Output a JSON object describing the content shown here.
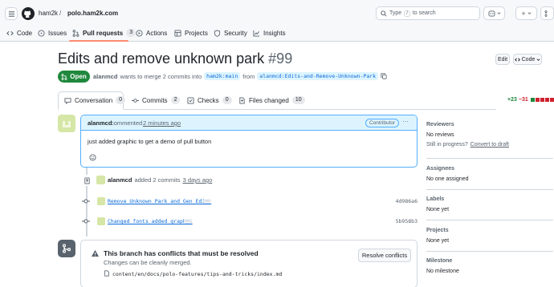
{
  "header": {
    "owner": "ham2k",
    "separator": "/",
    "repo": "polo.ham2k.com",
    "search_prefix": "Type",
    "search_key": "/",
    "search_suffix": "to search",
    "plus_label": "+"
  },
  "repo_tabs": [
    {
      "label": "Code",
      "icon": "code-icon"
    },
    {
      "label": "Issues",
      "icon": "issue-icon"
    },
    {
      "label": "Pull requests",
      "icon": "pull-request-icon",
      "count": "3"
    },
    {
      "label": "Actions",
      "icon": "play-icon"
    },
    {
      "label": "Projects",
      "icon": "table-icon"
    },
    {
      "label": "Security",
      "icon": "shield-icon"
    },
    {
      "label": "Insights",
      "icon": "graph-icon"
    }
  ],
  "pr": {
    "title": "Edits and remove unknown park",
    "number": "#99",
    "edit_label": "Edit",
    "code_label": "Code",
    "status": "Open",
    "author": "alanmcd",
    "merge_text_1": "wants to merge 2 commits into",
    "base_branch": "ham2k:main",
    "from_text": "from",
    "head_branch": "alanmcd:Edits-and-Remove-Unknown-Park"
  },
  "pr_tabs": [
    {
      "label": "Conversation",
      "count": "0"
    },
    {
      "label": "Commits",
      "count": "2"
    },
    {
      "label": "Checks",
      "count": "0"
    },
    {
      "label": "Files changed",
      "count": "10"
    }
  ],
  "diffstat": {
    "added": "+23",
    "removed": "−31"
  },
  "comment": {
    "author": "alanmcd",
    "action": "commented",
    "time": "2 minutes ago",
    "role": "Contributor",
    "more": "···",
    "body": "just added graphic to get a demo of pull button",
    "reaction_icon": "smiley-icon"
  },
  "commits_event": {
    "author": "alanmcd",
    "text": "added 2 commits",
    "time": "3 days ago",
    "commits": [
      {
        "message": "Remove Unknown Park and Gen Edits",
        "sha": "4d986a6",
        "more": "···"
      },
      {
        "message": "Changed fonts added graphic",
        "sha": "5b958b3",
        "more": "···"
      }
    ]
  },
  "merge": {
    "title": "This branch has conflicts that must be resolved",
    "subtitle": "Changes can be cleanly merged.",
    "resolve_label": "Resolve conflicts",
    "file": "content/en/docs/polo-features/tips-and-tricks/index.md"
  },
  "sidebar": {
    "reviewers_h": "Reviewers",
    "reviewers_v": "No reviews",
    "progress_q": "Still in progress?",
    "progress_link": "Convert to draft",
    "assignees_h": "Assignees",
    "assignees_v": "No one assigned",
    "labels_h": "Labels",
    "labels_v": "None yet",
    "projects_h": "Projects",
    "projects_v": "None yet",
    "milestone_h": "Milestone",
    "milestone_v": "No milestone"
  },
  "colors": {
    "accent": "#0969da",
    "open": "#1f883d",
    "tab_underline": "#fd8c73",
    "danger": "#cf222e"
  }
}
